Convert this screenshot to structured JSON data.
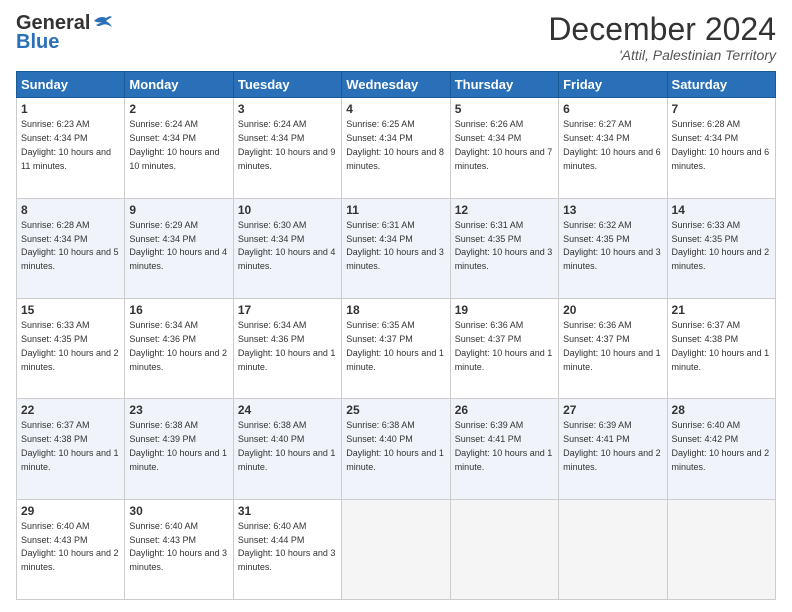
{
  "logo": {
    "line1": "General",
    "line2": "Blue"
  },
  "title": "December 2024",
  "location": "'Attil, Palestinian Territory",
  "weekdays": [
    "Sunday",
    "Monday",
    "Tuesday",
    "Wednesday",
    "Thursday",
    "Friday",
    "Saturday"
  ],
  "weeks": [
    [
      {
        "day": "1",
        "sunrise": "6:23 AM",
        "sunset": "4:34 PM",
        "daylight": "10 hours and 11 minutes."
      },
      {
        "day": "2",
        "sunrise": "6:24 AM",
        "sunset": "4:34 PM",
        "daylight": "10 hours and 10 minutes."
      },
      {
        "day": "3",
        "sunrise": "6:24 AM",
        "sunset": "4:34 PM",
        "daylight": "10 hours and 9 minutes."
      },
      {
        "day": "4",
        "sunrise": "6:25 AM",
        "sunset": "4:34 PM",
        "daylight": "10 hours and 8 minutes."
      },
      {
        "day": "5",
        "sunrise": "6:26 AM",
        "sunset": "4:34 PM",
        "daylight": "10 hours and 7 minutes."
      },
      {
        "day": "6",
        "sunrise": "6:27 AM",
        "sunset": "4:34 PM",
        "daylight": "10 hours and 6 minutes."
      },
      {
        "day": "7",
        "sunrise": "6:28 AM",
        "sunset": "4:34 PM",
        "daylight": "10 hours and 6 minutes."
      }
    ],
    [
      {
        "day": "8",
        "sunrise": "6:28 AM",
        "sunset": "4:34 PM",
        "daylight": "10 hours and 5 minutes."
      },
      {
        "day": "9",
        "sunrise": "6:29 AM",
        "sunset": "4:34 PM",
        "daylight": "10 hours and 4 minutes."
      },
      {
        "day": "10",
        "sunrise": "6:30 AM",
        "sunset": "4:34 PM",
        "daylight": "10 hours and 4 minutes."
      },
      {
        "day": "11",
        "sunrise": "6:31 AM",
        "sunset": "4:34 PM",
        "daylight": "10 hours and 3 minutes."
      },
      {
        "day": "12",
        "sunrise": "6:31 AM",
        "sunset": "4:35 PM",
        "daylight": "10 hours and 3 minutes."
      },
      {
        "day": "13",
        "sunrise": "6:32 AM",
        "sunset": "4:35 PM",
        "daylight": "10 hours and 3 minutes."
      },
      {
        "day": "14",
        "sunrise": "6:33 AM",
        "sunset": "4:35 PM",
        "daylight": "10 hours and 2 minutes."
      }
    ],
    [
      {
        "day": "15",
        "sunrise": "6:33 AM",
        "sunset": "4:35 PM",
        "daylight": "10 hours and 2 minutes."
      },
      {
        "day": "16",
        "sunrise": "6:34 AM",
        "sunset": "4:36 PM",
        "daylight": "10 hours and 2 minutes."
      },
      {
        "day": "17",
        "sunrise": "6:34 AM",
        "sunset": "4:36 PM",
        "daylight": "10 hours and 1 minute."
      },
      {
        "day": "18",
        "sunrise": "6:35 AM",
        "sunset": "4:37 PM",
        "daylight": "10 hours and 1 minute."
      },
      {
        "day": "19",
        "sunrise": "6:36 AM",
        "sunset": "4:37 PM",
        "daylight": "10 hours and 1 minute."
      },
      {
        "day": "20",
        "sunrise": "6:36 AM",
        "sunset": "4:37 PM",
        "daylight": "10 hours and 1 minute."
      },
      {
        "day": "21",
        "sunrise": "6:37 AM",
        "sunset": "4:38 PM",
        "daylight": "10 hours and 1 minute."
      }
    ],
    [
      {
        "day": "22",
        "sunrise": "6:37 AM",
        "sunset": "4:38 PM",
        "daylight": "10 hours and 1 minute."
      },
      {
        "day": "23",
        "sunrise": "6:38 AM",
        "sunset": "4:39 PM",
        "daylight": "10 hours and 1 minute."
      },
      {
        "day": "24",
        "sunrise": "6:38 AM",
        "sunset": "4:40 PM",
        "daylight": "10 hours and 1 minute."
      },
      {
        "day": "25",
        "sunrise": "6:38 AM",
        "sunset": "4:40 PM",
        "daylight": "10 hours and 1 minute."
      },
      {
        "day": "26",
        "sunrise": "6:39 AM",
        "sunset": "4:41 PM",
        "daylight": "10 hours and 1 minute."
      },
      {
        "day": "27",
        "sunrise": "6:39 AM",
        "sunset": "4:41 PM",
        "daylight": "10 hours and 2 minutes."
      },
      {
        "day": "28",
        "sunrise": "6:40 AM",
        "sunset": "4:42 PM",
        "daylight": "10 hours and 2 minutes."
      }
    ],
    [
      {
        "day": "29",
        "sunrise": "6:40 AM",
        "sunset": "4:43 PM",
        "daylight": "10 hours and 2 minutes."
      },
      {
        "day": "30",
        "sunrise": "6:40 AM",
        "sunset": "4:43 PM",
        "daylight": "10 hours and 3 minutes."
      },
      {
        "day": "31",
        "sunrise": "6:40 AM",
        "sunset": "4:44 PM",
        "daylight": "10 hours and 3 minutes."
      },
      null,
      null,
      null,
      null
    ]
  ]
}
